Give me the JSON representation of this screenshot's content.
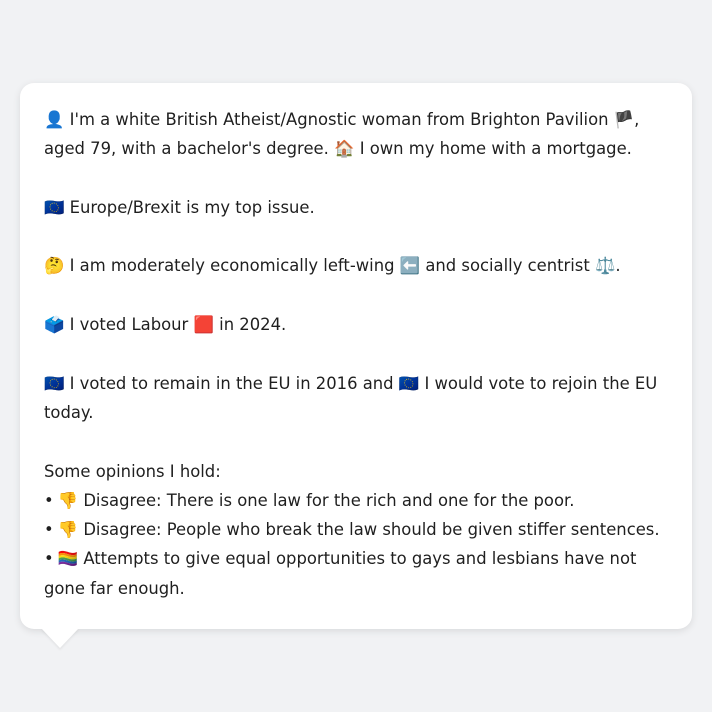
{
  "profile": {
    "intro_emoji": "👤",
    "intro_text_1": "I'm a white British Atheist/Agnostic woman from Brighton Pavilion",
    "england_flag": "🏴",
    "intro_text_2": ", aged 79, with a bachelor's degree.",
    "home_emoji": "🏠",
    "intro_text_3": "I own my home with a mortgage."
  },
  "top_issue": {
    "eu_flag": "🇪🇺",
    "text": "Europe/Brexit is my top issue."
  },
  "ideology": {
    "thinking_emoji": "🤔",
    "text_1": "I am moderately economically left-wing",
    "left_arrow_emoji": "⬅️",
    "text_2": "and socially centrist",
    "scales_emoji": "⚖️",
    "text_3": "."
  },
  "vote_2024": {
    "ballot_emoji": "🗳️",
    "text_1": "I voted Labour",
    "red_square_emoji": "🟥",
    "text_2": "in 2024."
  },
  "eu_vote": {
    "eu_flag_1": "🇪🇺",
    "text_1": "I voted to remain in the EU in 2016 and",
    "eu_flag_2": "🇪🇺",
    "text_2": "I would vote to rejoin the EU today."
  },
  "opinions": {
    "heading": "Some opinions I hold:",
    "bullet": "•",
    "items": [
      {
        "emoji": "👎",
        "text": "Disagree: There is one law for the rich and one for the poor."
      },
      {
        "emoji": "👎",
        "text": "Disagree: People who break the law should be given stiffer sentences."
      },
      {
        "emoji": "🏳️‍🌈",
        "text": "Attempts to give equal opportunities to gays and lesbians have not gone far enough."
      }
    ]
  }
}
